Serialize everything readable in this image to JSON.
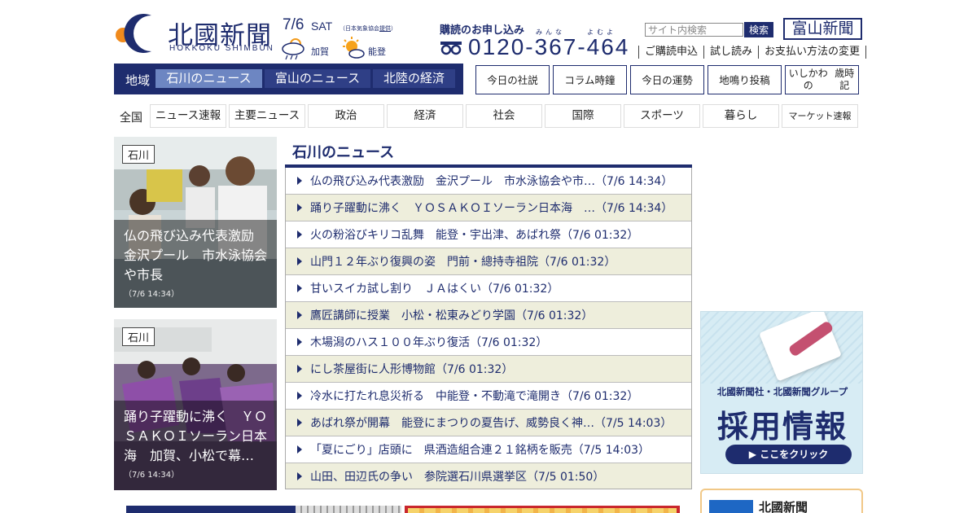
{
  "header": {
    "logo_text": "北國新聞",
    "logo_sub": "HOKKOKU SHIMBUN",
    "date": "7/6",
    "day_of_week": "SAT",
    "weather_credit_prefix": "（日本気象協会",
    "weather_credit_link": "提供",
    "weather_credit_suffix": "）",
    "weather": [
      {
        "region": "加賀",
        "icon": "cloudy-sunny-icon"
      },
      {
        "region": "能登",
        "icon": "sunny-cloudy-icon"
      }
    ],
    "subscribe_label": "購読のお申し込み",
    "phone_ruby_1": "みんな",
    "phone_ruby_2": "よむよ",
    "phone": "0120-367-464",
    "search_placeholder": "サイト内検索",
    "search_button": "検索",
    "toyama_logo": "富山新聞",
    "links": [
      "ご購読申込",
      "試し読み",
      "お支払い方法の変更"
    ]
  },
  "region_nav": {
    "label": "地域",
    "tabs": [
      {
        "label": "石川のニュース",
        "active": true
      },
      {
        "label": "富山のニュース",
        "active": false
      },
      {
        "label": "北陸の経済",
        "active": false
      }
    ]
  },
  "quick_links": [
    {
      "label": "今日の社説"
    },
    {
      "label": "コラム時鐘"
    },
    {
      "label": "今日の運勢"
    },
    {
      "label": "地鳴り投稿"
    },
    {
      "label_line1": "いしかわの",
      "label_line2": "歳時記"
    }
  ],
  "category_nav": {
    "label": "全国",
    "tabs": [
      "ニュース速報",
      "主要ニュース",
      "政治",
      "経済",
      "社会",
      "国際",
      "スポーツ",
      "暮らし",
      "マーケット速報"
    ]
  },
  "feature_cards": [
    {
      "tag": "石川",
      "headline": "仏の飛び込み代表激励　金沢プール　市水泳協会や市長",
      "time": "（7/6 14:34）"
    },
    {
      "tag": "石川",
      "headline": "踊り子躍動に沸く　ＹＯＳＡＫＯＩソーラン日本海　加賀、小松で幕…",
      "time": "（7/6 14:34）"
    }
  ],
  "news": {
    "title": "石川のニュース",
    "items": [
      "仏の飛び込み代表激励　金沢プール　市水泳協会や市…（7/6 14:34）",
      "踊り子躍動に沸く　ＹＯＳＡＫＯＩソーラン日本海　…（7/6 14:34）",
      "火の粉浴びキリコ乱舞　能登・宇出津、あばれ祭（7/6 01:32）",
      "山門１２年ぶり復興の姿　門前・總持寺祖院（7/6 01:32）",
      "甘いスイカ試し割り　ＪＡはくい（7/6 01:32）",
      "鷹匠講師に授業　小松・松東みどり学園（7/6 01:32）",
      "木場潟のハス１００年ぶり復活（7/6 01:32）",
      "にし茶屋街に人形博物館（7/6 01:32）",
      "冷水に打たれ息災祈る　中能登・不動滝で滝開き（7/6 01:32）",
      "あばれ祭が開幕　能登にまつりの夏告げ、威勢良く神…（7/5 14:03）",
      "「夏にごり」店頭に　県酒造組合連２１銘柄を販売（7/5 14:03）",
      "山田、田辺氏の争い　参院選石川県選挙区（7/5 01:50）"
    ]
  },
  "ads": {
    "recruit_line1": "北國新聞社・北國新聞グループ",
    "recruit_line2": "採用情報",
    "recruit_button": "ここをクリック",
    "bottom_ad_title": "北國新聞"
  },
  "colors": {
    "brand_navy": "#1e2c6e",
    "active_tab": "#6d86c2",
    "row_alt": "#eeeedc"
  }
}
